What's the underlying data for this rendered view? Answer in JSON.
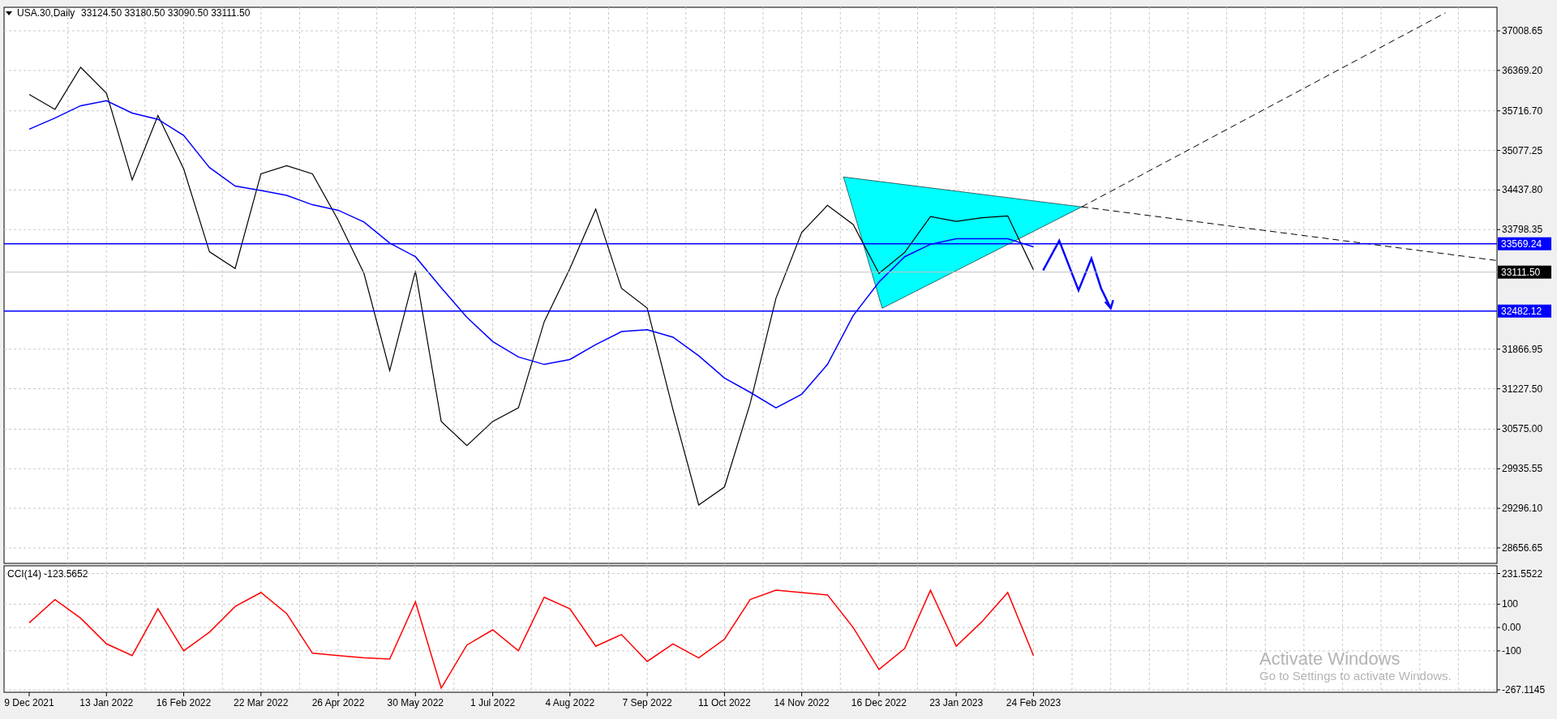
{
  "legend": {
    "quote": "33124.50 33180.50 33090.50 33111.50"
  },
  "price_chart": {
    "chart_data": {
      "type": "line",
      "grid": true,
      "ylim": [
        28407,
        37389
      ],
      "categories": [
        null,
        null,
        null,
        null,
        null,
        null,
        null,
        null,
        null,
        null,
        null,
        null,
        null,
        null,
        null,
        null,
        null,
        null,
        null,
        null,
        null,
        null,
        null,
        null,
        null,
        null,
        null,
        null,
        null,
        null,
        null,
        null,
        null,
        null,
        null,
        null,
        null,
        null,
        null,
        null,
        null,
        null,
        null,
        null,
        null,
        null,
        null,
        null,
        null,
        null,
        null,
        null,
        null,
        null,
        null,
        null,
        null,
        null
      ],
      "yticks": [
        {
          "value": 37008.65,
          "label": "37008.65"
        },
        {
          "value": 36369.2,
          "label": "36369.20"
        },
        {
          "value": 35716.7,
          "label": "35716.70"
        },
        {
          "value": 35077.25,
          "label": "35077.25"
        },
        {
          "value": 34437.8,
          "label": "34437.80"
        },
        {
          "value": 33798.35,
          "label": "33798.35"
        },
        {
          "value": 31866.95,
          "label": "31866.95"
        },
        {
          "value": 31227.5,
          "label": "31227.50"
        },
        {
          "value": 30575,
          "label": "30575.00"
        },
        {
          "value": 29935.55,
          "label": "29935.55"
        },
        {
          "value": 29296.1,
          "label": "29296.10"
        },
        {
          "value": 28656.65,
          "label": "28656.65"
        }
      ],
      "ref_lines": [
        {
          "axis": "y",
          "value": 33569.24,
          "label": "33569.24",
          "color": "#0000ff"
        },
        {
          "axis": "y",
          "value": 33111.5,
          "label": "33111.50",
          "color": "#c0c0c0"
        },
        {
          "axis": "y",
          "value": 32482.12,
          "label": "32482.12",
          "color": "#0000ff"
        }
      ],
      "series": [
        {
          "name": "USA.30,Daily",
          "color": "#000000",
          "values": [
            35980,
            35740,
            36420,
            36000,
            34600,
            35640,
            34780,
            33440,
            33170,
            34700,
            34830,
            34700,
            33950,
            33090,
            31520,
            33130,
            30700,
            30310,
            30700,
            30920,
            32310,
            33170,
            34130,
            32850,
            32530,
            30890,
            29350,
            29640,
            30990,
            32690,
            33750,
            34190,
            33880,
            33090,
            33430,
            34010,
            33930,
            33990,
            34020,
            33150,
            null,
            null,
            null,
            null,
            null,
            null,
            null,
            null,
            null,
            null,
            null,
            null,
            null,
            null,
            null,
            null,
            null,
            null
          ]
        },
        {
          "color": "#0000ff",
          "values": [
            35420,
            35600,
            35800,
            35880,
            35680,
            35580,
            35320,
            34800,
            34500,
            34430,
            34350,
            34200,
            34110,
            33920,
            33580,
            33360,
            32860,
            32380,
            31990,
            31740,
            31620,
            31700,
            31940,
            32150,
            32180,
            32060,
            31760,
            31400,
            31170,
            30920,
            31140,
            31620,
            32410,
            32950,
            33360,
            33560,
            33650,
            33650,
            33650,
            33520,
            null,
            null,
            null,
            null,
            null,
            null,
            null,
            null,
            null,
            null,
            null,
            null,
            null,
            null,
            null,
            null,
            null,
            null
          ]
        }
      ]
    }
  },
  "indicator": {
    "value": "-123.5652",
    "chart_data": {
      "type": "line",
      "grid": true,
      "ylim": [
        -277.5,
        264.6
      ],
      "categories": [
        "9 Dec 2021",
        null,
        null,
        "13 Jan 2022",
        null,
        null,
        "16 Feb 2022",
        null,
        null,
        "22 Mar 2022",
        null,
        null,
        "26 Apr 2022",
        null,
        null,
        "30 May 2022",
        null,
        null,
        "1 Jul 2022",
        null,
        null,
        "4 Aug 2022",
        null,
        null,
        "7 Sep 2022",
        null,
        null,
        "11 Oct 2022",
        null,
        null,
        "14 Nov 2022",
        null,
        null,
        "16 Dec 2022",
        null,
        null,
        "23 Jan 2023",
        null,
        null,
        "24 Feb 2023",
        null,
        null,
        null,
        null,
        null,
        null,
        null,
        null,
        null,
        null,
        null,
        null,
        null,
        null,
        null,
        null,
        null,
        null
      ],
      "yticks": [
        {
          "value": 231.5522,
          "label": "231.5522"
        },
        {
          "value": 100,
          "label": "100"
        },
        {
          "value": 0,
          "label": "0.00"
        },
        {
          "value": -100,
          "label": "-100"
        },
        {
          "value": -267.1145,
          "label": "-267.1145"
        }
      ],
      "series": [
        {
          "name": "CCI(14)",
          "color": "#ff0000",
          "values": [
            20,
            120,
            40,
            -70,
            -120,
            80,
            -100,
            -20,
            90,
            150,
            60,
            -110,
            -120,
            -130,
            -135,
            110,
            -260,
            -75,
            -10,
            -100,
            130,
            80,
            -80,
            -30,
            -145,
            -70,
            -130,
            -50,
            120,
            160,
            150,
            140,
            0,
            -180,
            -90,
            160,
            -80,
            25,
            150,
            -120,
            null,
            null,
            null,
            null,
            null,
            null,
            null,
            null,
            null,
            null,
            null,
            null,
            null,
            null,
            null,
            null,
            null,
            null
          ]
        }
      ]
    }
  },
  "os_notice": {
    "title": "Activate Windows",
    "text": "Go to Settings to activate Windows."
  }
}
